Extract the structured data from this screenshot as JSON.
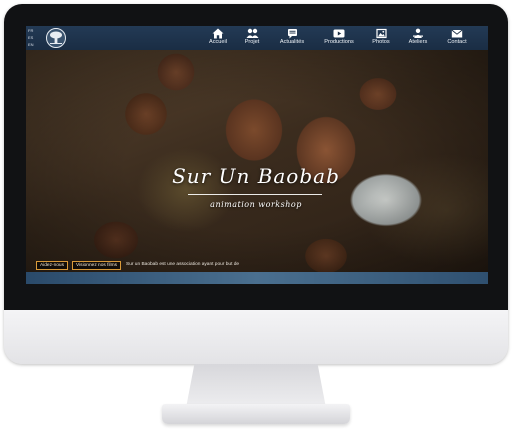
{
  "languages": [
    "FR",
    "ES",
    "EN"
  ],
  "nav": {
    "items": [
      {
        "label": "Accueil",
        "icon": "home-icon"
      },
      {
        "label": "Projet",
        "icon": "people-icon"
      },
      {
        "label": "Actualités",
        "icon": "news-icon"
      },
      {
        "label": "Productions",
        "icon": "video-play-icon"
      },
      {
        "label": "Photos",
        "icon": "photo-icon"
      },
      {
        "label": "Ateliers",
        "icon": "workshop-icon"
      },
      {
        "label": "Contact",
        "icon": "envelope-icon"
      }
    ]
  },
  "hero": {
    "title": "Sur Un Baobab",
    "subtitle": "animation workshop",
    "cta_help": "Aidez-nous",
    "cta_films": "Visionnez nos films",
    "intro_text": "Sur un Baobab est une association ayant pour but de"
  },
  "colors": {
    "nav_background": "#1a2d44",
    "cta_border": "#d99a3a",
    "footer_band": "#4a6f8f"
  }
}
